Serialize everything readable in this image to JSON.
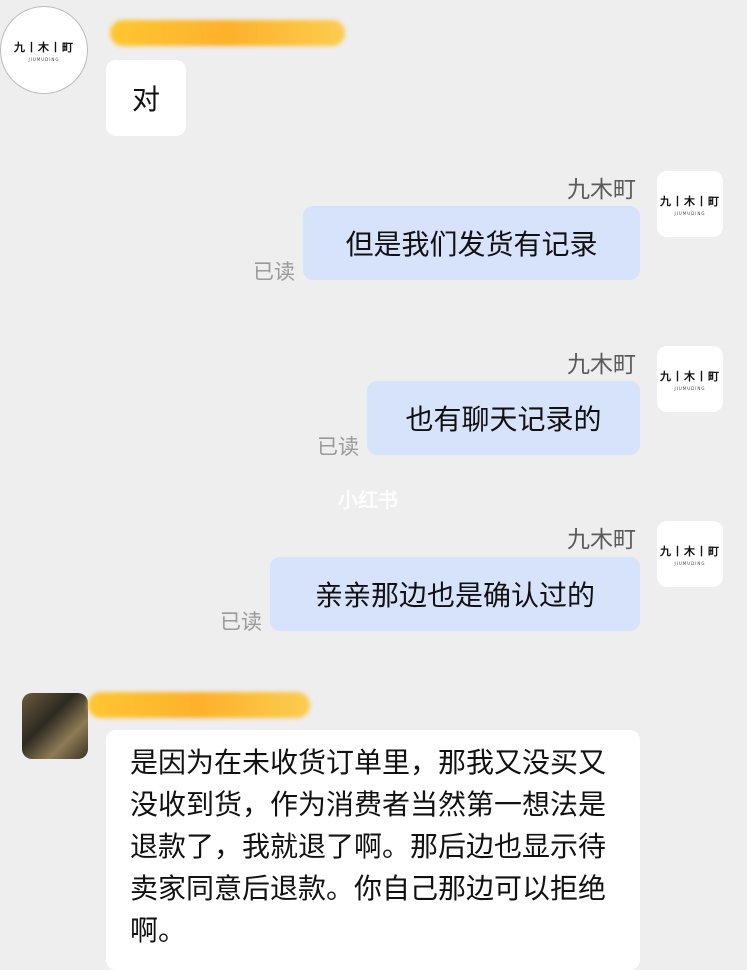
{
  "contact": {
    "name": "九木町",
    "logo_text": "九丨木丨町",
    "logo_sub": "JIUMUDING"
  },
  "messages": [
    {
      "text": "对"
    },
    {
      "text": "但是我们发货有记录",
      "read": "已读"
    },
    {
      "text": "也有聊天记录的",
      "read": "已读"
    },
    {
      "text": "亲亲那边也是确认过的",
      "read": "已读"
    },
    {
      "text": "是因为在未收货订单里，那我又没买又没收到货，作为消费者当然第一想法是退款了，我就退了啊。那后边也显示待卖家同意后退款。你自己那边可以拒绝啊。"
    }
  ],
  "watermark": "小红书",
  "colors": {
    "background": "#eeeeef",
    "incoming_bubble": "#ffffff",
    "outgoing_bubble": "#d7e3fb",
    "redaction": "#ffb820"
  }
}
